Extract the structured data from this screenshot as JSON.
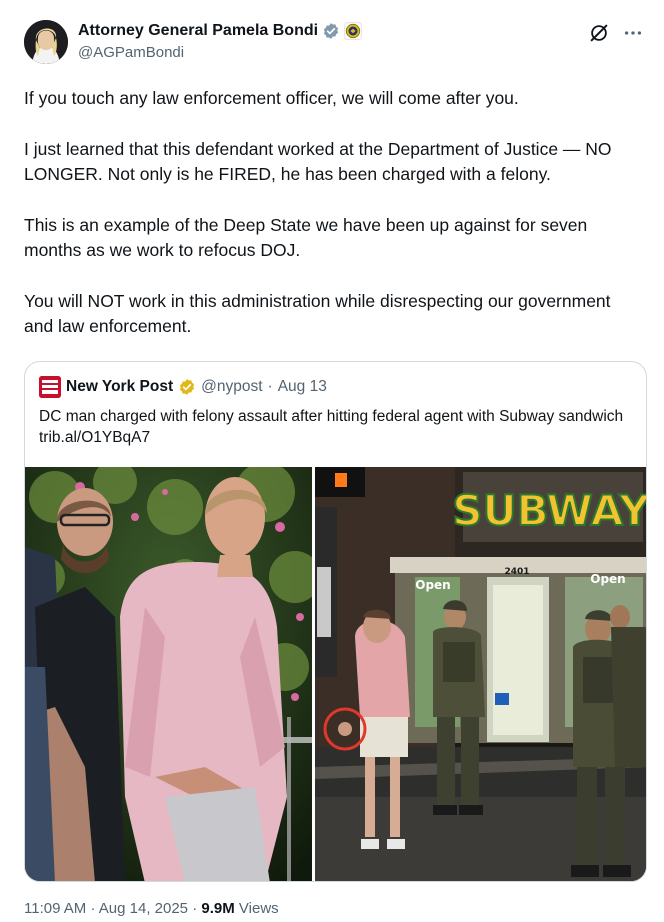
{
  "author": {
    "name": "Attorney General Pamela Bondi",
    "handle": "@AGPamBondi"
  },
  "tweet": {
    "paragraphs": [
      "If you touch any law enforcement officer, we will come after you.",
      "I just learned that this defendant worked at the Department of Justice — NO LONGER. Not only is he FIRED, he has been charged with a felony.",
      "This is an example of the Deep State we have been up against for seven months as we work to refocus DOJ.",
      "You will NOT work in this administration while disrespecting our government and law enforcement."
    ]
  },
  "quote": {
    "name": "New York Post",
    "handle": "@nypost",
    "separator": "·",
    "date": "Aug 13",
    "text": "DC man charged with felony assault after hitting federal agent with Subway sandwich trib.al/O1YBqA7",
    "logo_text": "NEW YORK POST"
  },
  "photo_right": {
    "sign_text": "SUBWAY",
    "open_label": "Open",
    "address": "2401"
  },
  "meta": {
    "time": "11:09 AM",
    "dot1": "·",
    "date": "Aug 14, 2025",
    "dot2": "·",
    "views_count": "9.9M",
    "views_label": "Views"
  },
  "colors": {
    "text_primary": "#0f1419",
    "text_secondary": "#536471",
    "border": "#cfd9de",
    "verified_gray": "#829aab",
    "nypost_red": "#c8102e",
    "verified_gold": "#e2b719"
  },
  "icons": {
    "verified": "verified-gray-check-icon",
    "seal": "doj-seal-icon",
    "grok": "grok-icon",
    "more": "more-options-icon",
    "quote_verified": "verified-gold-check-icon"
  }
}
